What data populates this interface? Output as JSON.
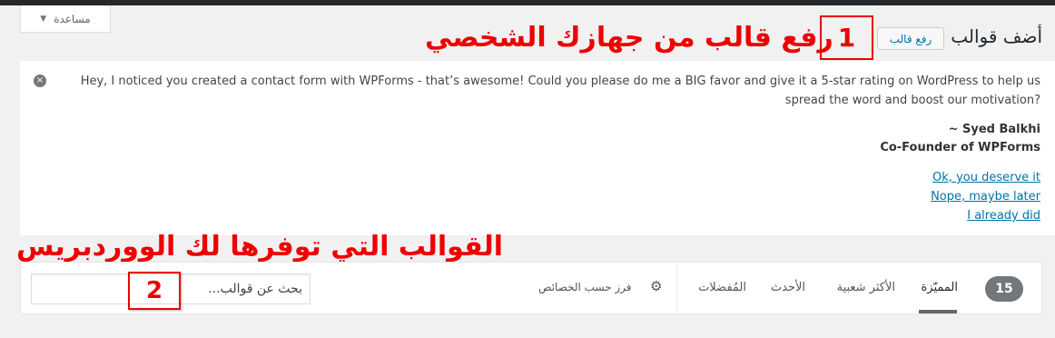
{
  "help_tab": {
    "label": "مساعدة",
    "arrow": "▼"
  },
  "header": {
    "title": "أضف قوالب",
    "upload_button": "رفع قالب"
  },
  "annotations": {
    "box1_number": "1",
    "text1": "رفع قالب من جهازك الشخصي",
    "box2_number": "2",
    "text2": "القوالب التي توفرها لك الووردبريس"
  },
  "notice": {
    "close_icon": "×",
    "message": "Hey, I noticed you created a contact form with WPForms - that’s awesome! Could you please do me a BIG favor and give it a 5-star rating on WordPress to help us spread the word and boost our motivation?",
    "signature_name": "~ Syed Balkhi",
    "signature_title": "Co-Founder of WPForms",
    "links": [
      "Ok, you deserve it",
      "Nope, maybe later",
      "I already did"
    ]
  },
  "filter": {
    "count": "15",
    "tabs": [
      "المميّزة",
      "الأكثر شعبية",
      "الأحدث",
      "المُفضلات"
    ],
    "feature_filter": "فرز حسب الخصائص",
    "gear_icon": "gear-icon",
    "search_placeholder": "بحث عن قوالب..."
  },
  "colors": {
    "accent": "#0073aa",
    "annotation": "#e00000",
    "topbar": "#23282d"
  }
}
